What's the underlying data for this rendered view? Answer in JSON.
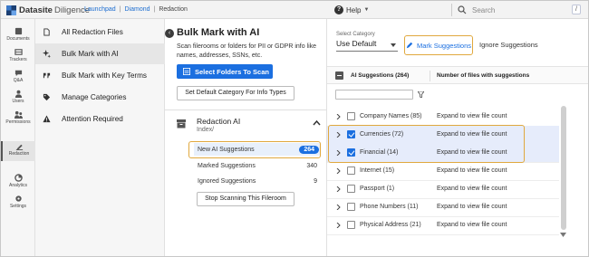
{
  "app": {
    "brand": "Datasite",
    "product": "Diligence",
    "breadcrumbs": [
      "Launchpad",
      "Diamond",
      "Redaction"
    ],
    "help_label": "Help",
    "search_placeholder": "Search",
    "search_shortcut": "/"
  },
  "rail": {
    "items": [
      {
        "label": "Documents",
        "icon": "documents-icon"
      },
      {
        "label": "Trackers",
        "icon": "trackers-icon"
      },
      {
        "label": "Q&A",
        "icon": "qa-icon"
      },
      {
        "label": "Users",
        "icon": "users-icon"
      },
      {
        "label": "Permissions",
        "icon": "permissions-icon"
      },
      {
        "label": "Redaction",
        "icon": "redaction-icon",
        "active": true
      },
      {
        "label": "Analytics",
        "icon": "analytics-icon"
      },
      {
        "label": "Settings",
        "icon": "settings-icon"
      }
    ]
  },
  "subnav": {
    "items": [
      {
        "label": "All Redaction Files",
        "icon": "file-icon"
      },
      {
        "label": "Bulk Mark with AI",
        "icon": "sparkle-icon",
        "active": true
      },
      {
        "label": "Bulk Mark with Key Terms",
        "icon": "quote-icon"
      },
      {
        "label": "Manage Categories",
        "icon": "tag-icon"
      },
      {
        "label": "Attention Required",
        "icon": "warning-icon"
      }
    ]
  },
  "bulk": {
    "title": "Bulk Mark with AI",
    "description": "Scan filerooms or folders for PII or GDPR info like names, addresses, SSNs, etc.",
    "select_folders_label": "Select Folders To Scan",
    "set_default_label": "Set Default Category For Info Types",
    "fileroom_title": "Redaction AI",
    "fileroom_path": "Index/",
    "suggestions": [
      {
        "label": "New AI Suggestions",
        "count": "264",
        "selected": true
      },
      {
        "label": "Marked Suggestions",
        "count": "340"
      },
      {
        "label": "Ignored Suggestions",
        "count": "9"
      }
    ],
    "stop_label": "Stop Scanning This Fileroom"
  },
  "suggestions_panel": {
    "category_label": "Select Category",
    "category_value": "Use Default",
    "mark_label": "Mark Suggestions",
    "ignore_label": "Ignore Suggestions",
    "col_name": "AI Suggestions (264)",
    "col_files": "Number of files with suggestions",
    "rows": [
      {
        "name": "Company Names (85)",
        "files": "Expand to view file count",
        "checked": false
      },
      {
        "name": "Currencies (72)",
        "files": "Expand to view file count",
        "checked": true
      },
      {
        "name": "Financial (14)",
        "files": "Expand to view file count",
        "checked": true
      },
      {
        "name": "Internet (15)",
        "files": "Expand to view file count",
        "checked": false
      },
      {
        "name": "Passport (1)",
        "files": "Expand to view file count",
        "checked": false
      },
      {
        "name": "Phone Numbers (11)",
        "files": "Expand to view file count",
        "checked": false
      },
      {
        "name": "Physical Address (21)",
        "files": "Expand to view file count",
        "checked": false
      }
    ]
  },
  "colors": {
    "accent": "#1b6fe0",
    "highlight": "#e0a83e",
    "row_selected": "#e6ecfb"
  }
}
